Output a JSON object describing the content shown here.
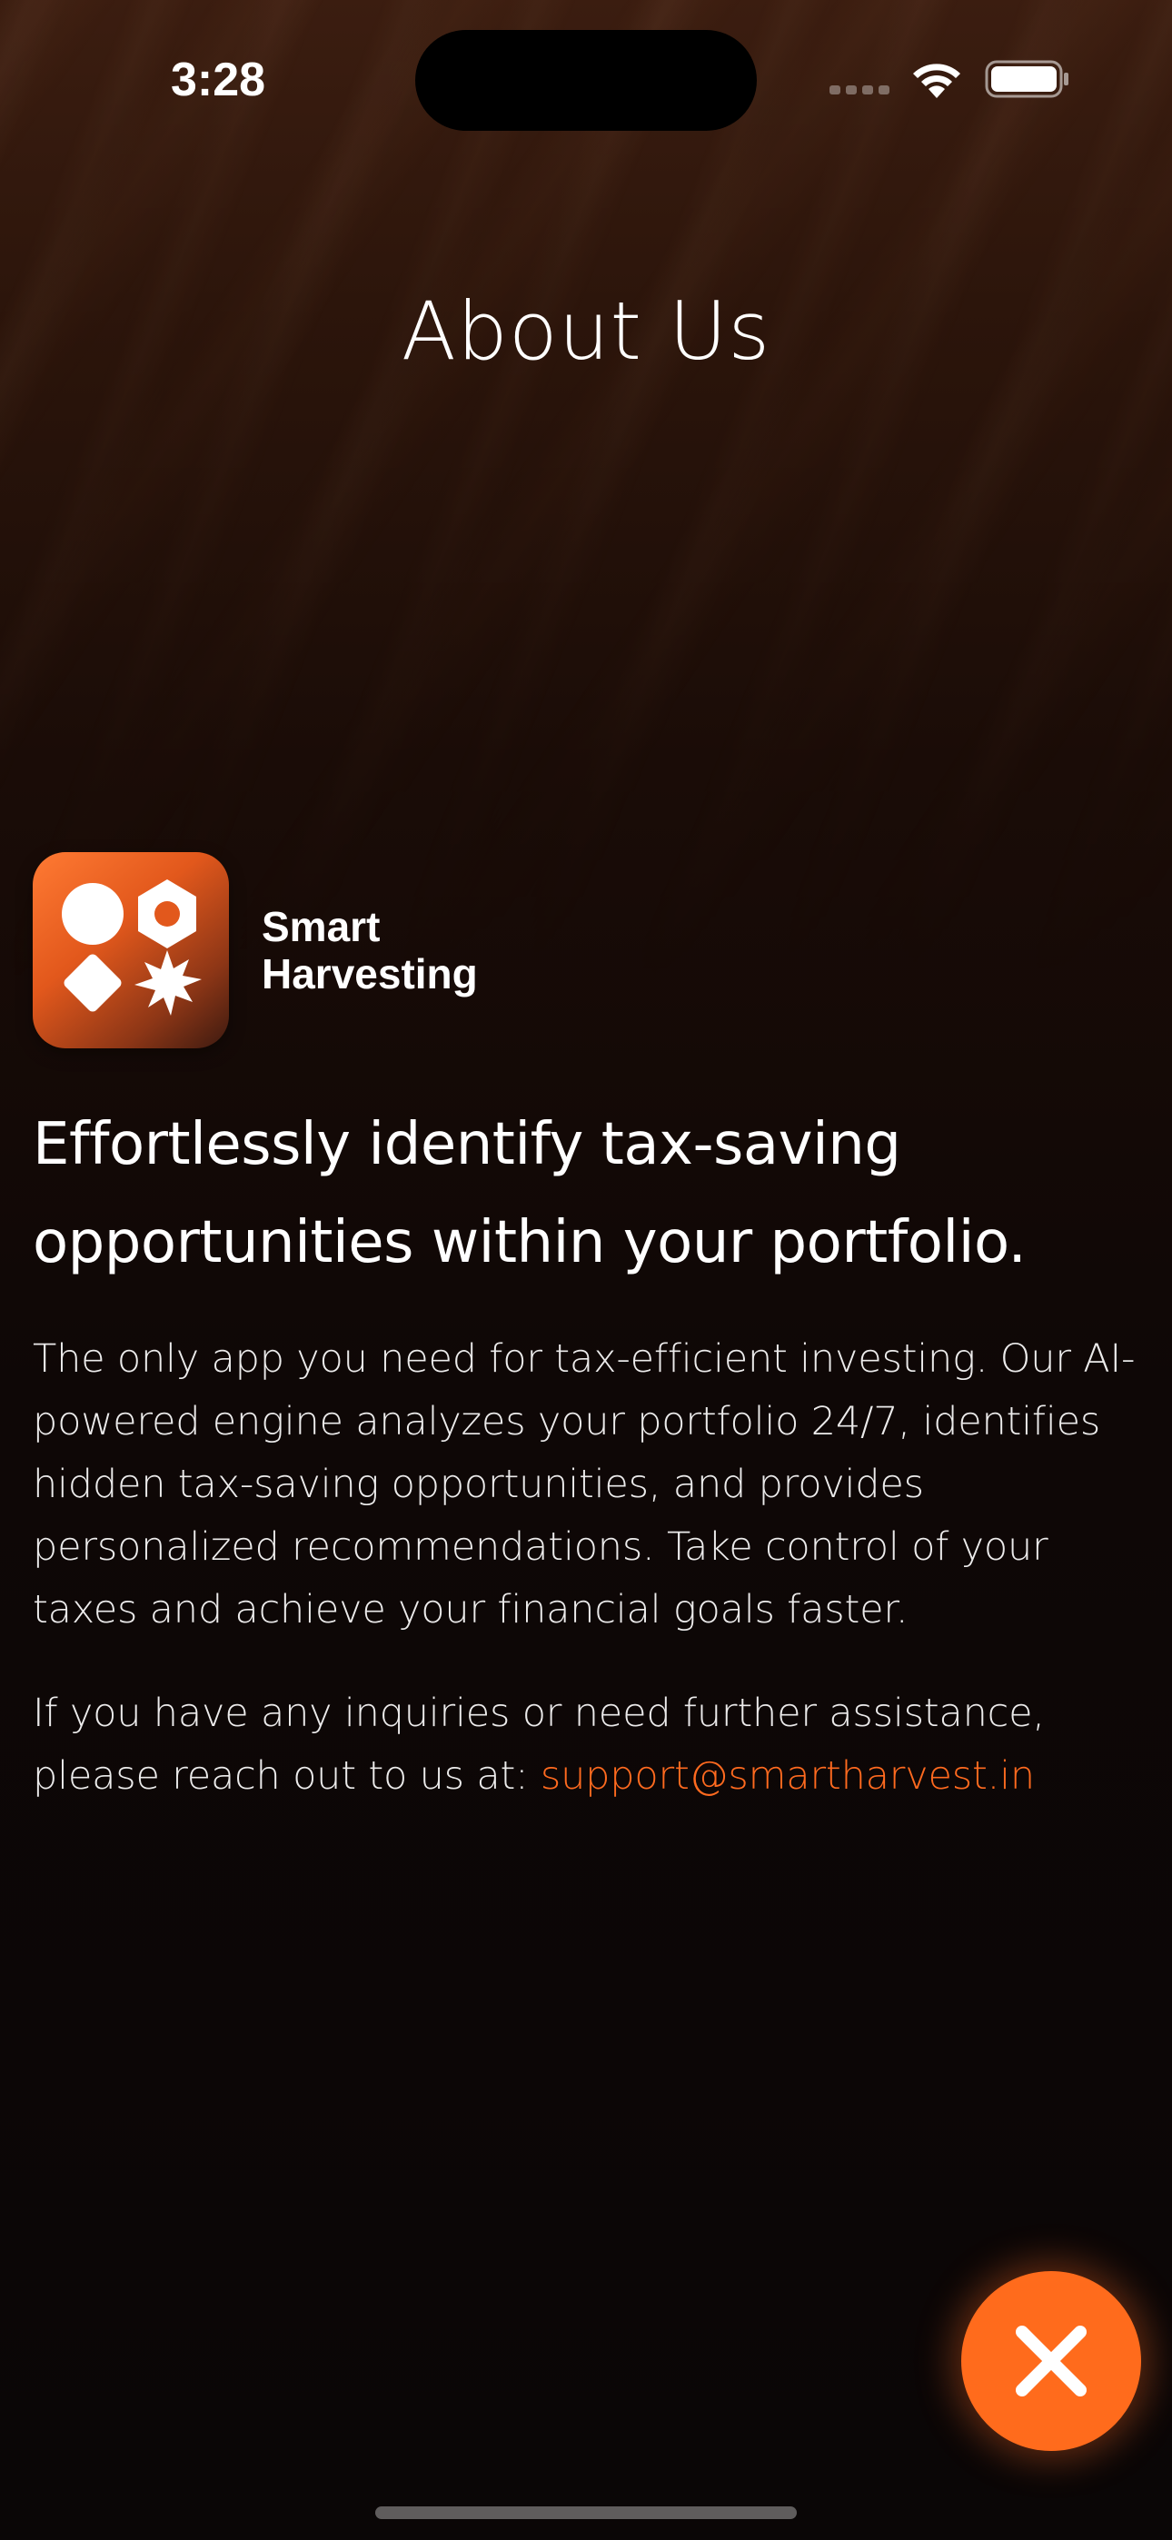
{
  "status_bar": {
    "time": "3:28",
    "icons": [
      "signal-icon",
      "wifi-icon",
      "battery-icon"
    ]
  },
  "header": {
    "title": "About Us"
  },
  "brand": {
    "logo_icon": "app-logo-icon",
    "name_line1": "Smart",
    "name_line2": "Harvesting"
  },
  "content": {
    "headline": "Effortlessly identify tax-saving opportunities within your portfolio.",
    "description": "The only app you need for tax-efficient investing. Our AI-powered engine analyzes your portfolio 24/7, identifies hidden tax-saving opportunities, and provides personalized recommendations. Take control of your taxes and achieve your financial goals faster.",
    "contact_text": "If you have any inquiries or need further assistance, please reach out to us at: ",
    "contact_email": "support@smartharvest.in"
  },
  "actions": {
    "close_icon": "close-icon"
  },
  "colors": {
    "accent": "#ff6b1c",
    "link": "#ff6a1f",
    "background_top": "#3b1d10",
    "background_bottom": "#0a0606"
  }
}
